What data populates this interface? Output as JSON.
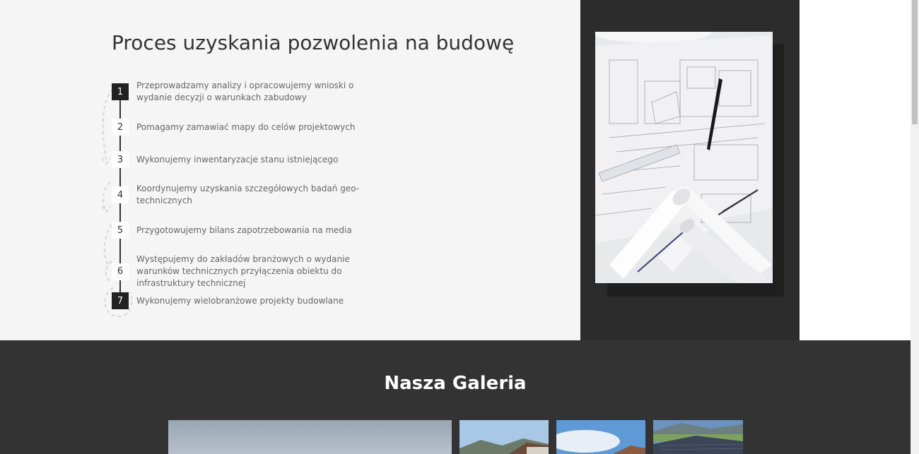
{
  "process": {
    "title": "Proces uzyskania pozwolenia na budowę",
    "steps": [
      {
        "number": "1",
        "text": "Przeprowadzamy analizy i opracowujemy wnioski o wydanie decyzji o warunkach zabudowy"
      },
      {
        "number": "2",
        "text": "Pomagamy zamawiać mapy do celów projektowych"
      },
      {
        "number": "3",
        "text": "Wykonujemy inwentaryzacje stanu istniejącego"
      },
      {
        "number": "4",
        "text": "Koordynujemy uzyskania szczegółowych badań geo-technicznych"
      },
      {
        "number": "5",
        "text": "Przygotowujemy bilans zapotrzebowania na media"
      },
      {
        "number": "6",
        "text": "Występujemy do zakładów branżowych o wydanie warunków technicznych przyłączenia obiektu do infrastruktury technicznej"
      },
      {
        "number": "7",
        "text": "Wykonujemy wielobranżowe projekty budowlane"
      }
    ],
    "image_subject": "architectural blueprints with pen, compass and rolled plans"
  },
  "gallery": {
    "title": "Nasza Galeria",
    "thumbnails": [
      "house-photo-1",
      "house-photo-2",
      "house-photo-3",
      "house-photo-4"
    ]
  },
  "colors": {
    "background_light": "#f5f5f5",
    "dark": "#333333",
    "accent_dark": "#222222"
  }
}
